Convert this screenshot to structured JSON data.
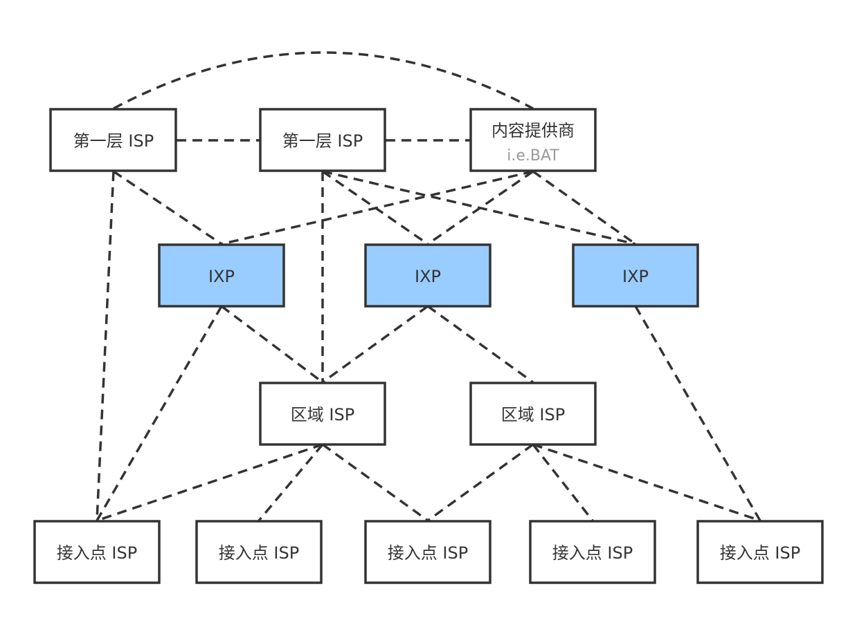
{
  "colors": {
    "stroke": "#333333",
    "box_fill": "#ffffff",
    "ixp_fill": "#99ccff",
    "text": "#333333",
    "sublabel_text": "#999999"
  },
  "nodes": {
    "tier1_a": {
      "label": "第一层 ISP"
    },
    "tier1_b": {
      "label": "第一层 ISP"
    },
    "content": {
      "label": "内容提供商",
      "sublabel": "i.e.BAT"
    },
    "ixp_1": {
      "label": "IXP"
    },
    "ixp_2": {
      "label": "IXP"
    },
    "ixp_3": {
      "label": "IXP"
    },
    "regional_1": {
      "label": "区域 ISP"
    },
    "regional_2": {
      "label": "区域 ISP"
    },
    "access_1": {
      "label": "接入点 ISP"
    },
    "access_2": {
      "label": "接入点 ISP"
    },
    "access_3": {
      "label": "接入点 ISP"
    },
    "access_4": {
      "label": "接入点 ISP"
    },
    "access_5": {
      "label": "接入点 ISP"
    }
  },
  "edges": [
    [
      "tier1_a",
      "tier1_b"
    ],
    [
      "tier1_b",
      "content"
    ],
    [
      "tier1_a",
      "content"
    ],
    [
      "tier1_a",
      "ixp_1"
    ],
    [
      "tier1_a",
      "access_1"
    ],
    [
      "tier1_b",
      "regional_1"
    ],
    [
      "tier1_b",
      "ixp_2"
    ],
    [
      "tier1_b",
      "ixp_3"
    ],
    [
      "content",
      "ixp_1"
    ],
    [
      "content",
      "ixp_2"
    ],
    [
      "content",
      "ixp_3"
    ],
    [
      "ixp_1",
      "regional_1"
    ],
    [
      "ixp_1",
      "access_1"
    ],
    [
      "ixp_2",
      "regional_1"
    ],
    [
      "ixp_2",
      "regional_2"
    ],
    [
      "ixp_3",
      "access_5"
    ],
    [
      "regional_1",
      "access_1"
    ],
    [
      "regional_1",
      "access_2"
    ],
    [
      "regional_1",
      "access_3"
    ],
    [
      "regional_2",
      "access_3"
    ],
    [
      "regional_2",
      "access_4"
    ],
    [
      "regional_2",
      "access_5"
    ]
  ]
}
